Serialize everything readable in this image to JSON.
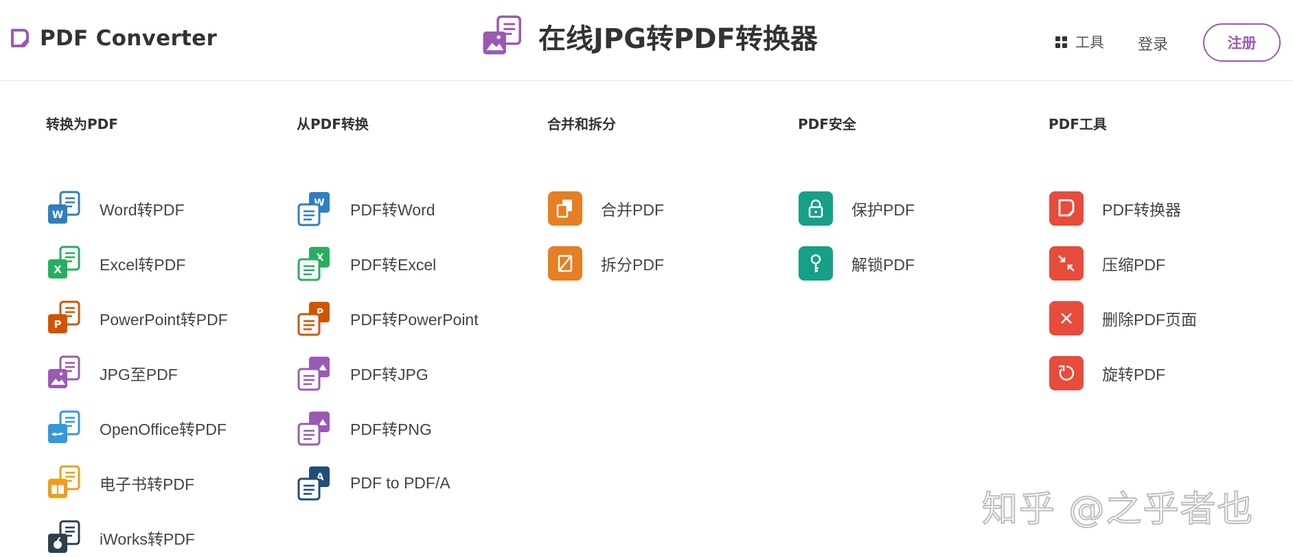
{
  "header": {
    "brand_name": "PDF Converter",
    "title": "在线JPG转PDF转换器",
    "tools_label": "工具",
    "login_label": "登录",
    "register_label": "注册"
  },
  "colors": {
    "brand_purple": "#9b59b6",
    "word_blue": "#2f7ec1",
    "excel_green": "#27ae60",
    "powerpoint_orange": "#d35400",
    "jpg_purple": "#9b59b6",
    "openoffice_blue": "#3498db",
    "ebook_yellow": "#f39c12",
    "iworks_navy": "#2c3e50",
    "pdfa_navy": "#1f4e79",
    "merge_orange": "#e67e22",
    "security_teal": "#16a085",
    "tools_red": "#e74c3c"
  },
  "columns": [
    {
      "title": "转换为PDF",
      "items": [
        {
          "label": "Word转PDF",
          "icon": "word-to-pdf-icon"
        },
        {
          "label": "Excel转PDF",
          "icon": "excel-to-pdf-icon"
        },
        {
          "label": "PowerPoint转PDF",
          "icon": "powerpoint-to-pdf-icon"
        },
        {
          "label": "JPG至PDF",
          "icon": "jpg-to-pdf-icon"
        },
        {
          "label": "OpenOffice转PDF",
          "icon": "openoffice-to-pdf-icon"
        },
        {
          "label": "电子书转PDF",
          "icon": "ebook-to-pdf-icon"
        },
        {
          "label": "iWorks转PDF",
          "icon": "iworks-to-pdf-icon"
        }
      ]
    },
    {
      "title": "从PDF转换",
      "items": [
        {
          "label": "PDF转Word",
          "icon": "pdf-to-word-icon"
        },
        {
          "label": "PDF转Excel",
          "icon": "pdf-to-excel-icon"
        },
        {
          "label": "PDF转PowerPoint",
          "icon": "pdf-to-powerpoint-icon"
        },
        {
          "label": "PDF转JPG",
          "icon": "pdf-to-jpg-icon"
        },
        {
          "label": "PDF转PNG",
          "icon": "pdf-to-png-icon"
        },
        {
          "label": "PDF to PDF/A",
          "icon": "pdf-to-pdfa-icon"
        }
      ]
    },
    {
      "title": "合并和拆分",
      "items": [
        {
          "label": "合并PDF",
          "icon": "merge-icon"
        },
        {
          "label": "拆分PDF",
          "icon": "split-icon"
        }
      ]
    },
    {
      "title": "PDF安全",
      "items": [
        {
          "label": "保护PDF",
          "icon": "lock-icon"
        },
        {
          "label": "解锁PDF",
          "icon": "key-icon"
        }
      ]
    },
    {
      "title": "PDF工具",
      "items": [
        {
          "label": "PDF转换器",
          "icon": "converter-icon"
        },
        {
          "label": "压缩PDF",
          "icon": "compress-icon"
        },
        {
          "label": "删除PDF页面",
          "icon": "delete-page-icon"
        },
        {
          "label": "旋转PDF",
          "icon": "rotate-icon"
        }
      ]
    }
  ],
  "watermark": "知乎 @之乎者也"
}
